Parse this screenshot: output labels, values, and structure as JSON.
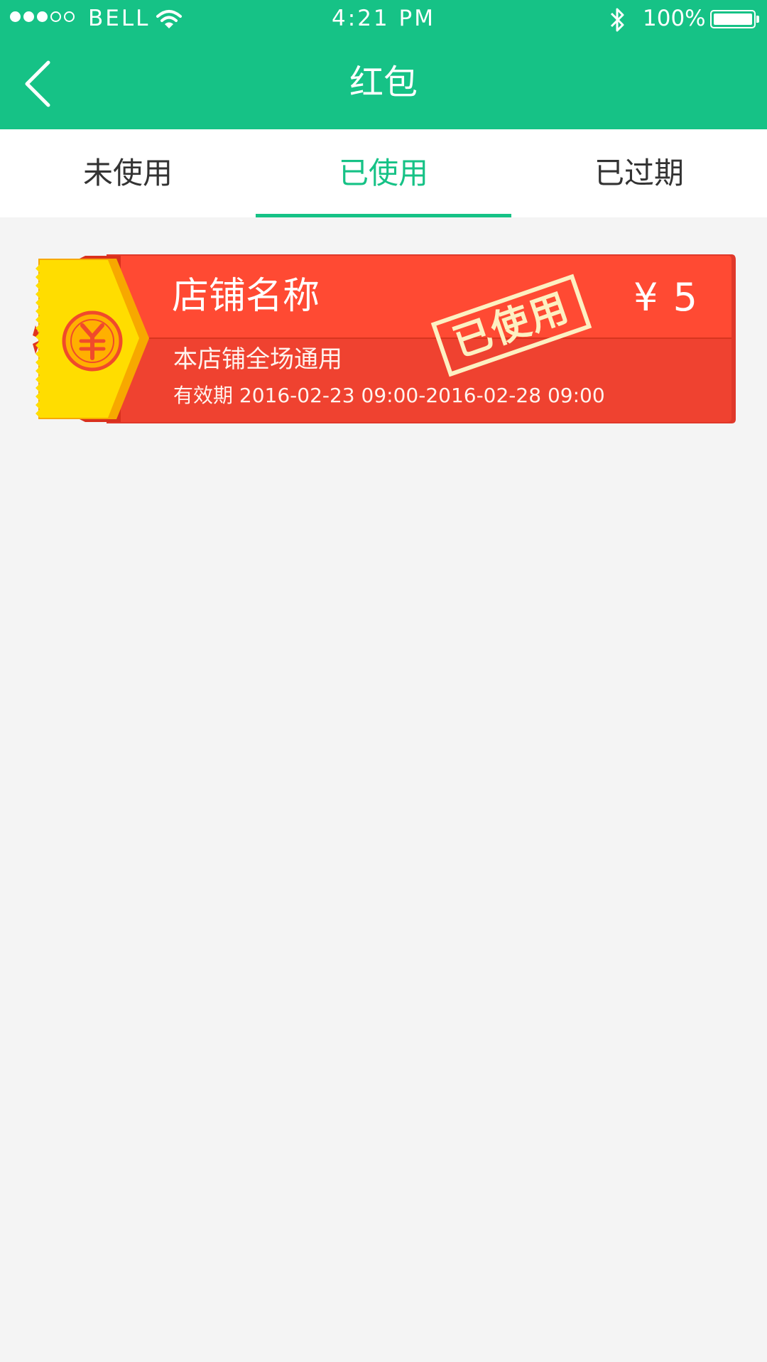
{
  "status_bar": {
    "carrier": "BELL",
    "time": "4:21 PM",
    "battery": "100%",
    "signal_bars_filled": 3,
    "signal_bars_total": 5
  },
  "nav": {
    "title": "红包"
  },
  "tabs": [
    {
      "label": "未使用",
      "active": false
    },
    {
      "label": "已使用",
      "active": true
    },
    {
      "label": "已过期",
      "active": false
    }
  ],
  "coupons": [
    {
      "store_name": "店铺名称",
      "amount": "¥ 5",
      "scope": "本店铺全场通用",
      "validity": "有效期 2016-02-23 09:00-2016-02-28 09:00",
      "stamp": "已使用",
      "icon": "yen-coin-icon"
    }
  ],
  "colors": {
    "primary": "#16c286",
    "coupon_red": "#f24a35",
    "coupon_yellow": "#ffdd00",
    "page_bg": "#f4f4f4",
    "stamp": "#fdf0c2"
  }
}
